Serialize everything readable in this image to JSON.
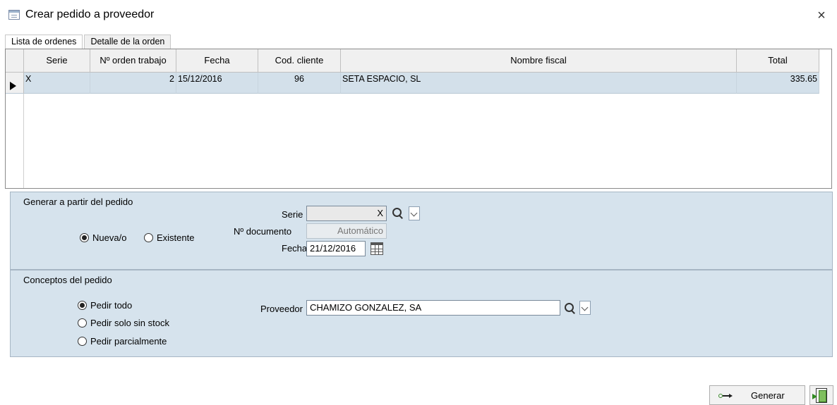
{
  "window": {
    "title": "Crear pedido a proveedor",
    "close_symbol": "×"
  },
  "tabs": [
    {
      "label": "Lista de ordenes",
      "active": true
    },
    {
      "label": "Detalle de la orden",
      "active": false
    }
  ],
  "grid": {
    "columns": [
      "Serie",
      "Nº orden trabajo",
      "Fecha",
      "Cod. cliente",
      "Nombre fiscal",
      "Total"
    ],
    "rows": [
      {
        "serie": "X",
        "orden": "2",
        "fecha": "15/12/2016",
        "cliente": "96",
        "nombre": "SETA ESPACIO, SL",
        "total": "335.65"
      }
    ]
  },
  "generar": {
    "title": "Generar a partir del pedido",
    "radio_nueva": "Nueva/o",
    "radio_existente": "Existente",
    "serie_label": "Serie",
    "serie_value": "X",
    "documento_label": "Nº documento",
    "documento_value": "Automático",
    "fecha_label": "Fecha",
    "fecha_value": "21/12/2016"
  },
  "conceptos": {
    "title": "Conceptos del pedido",
    "radio_todo": "Pedir todo",
    "radio_sin_stock": "Pedir solo sin stock",
    "radio_parcial": "Pedir parcialmente",
    "proveedor_label": "Proveedor",
    "proveedor_value": "CHAMIZO GONZALEZ, SA"
  },
  "footer": {
    "generar_label": "Generar"
  },
  "colors": {
    "selected_row": "#d3e0ea",
    "panel": "#d6e3ed"
  }
}
